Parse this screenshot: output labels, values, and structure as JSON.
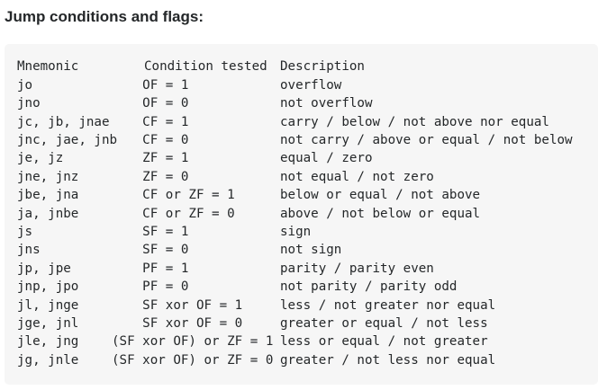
{
  "heading": "Jump conditions and flags:",
  "table": {
    "header": {
      "mnemonic": "Mnemonic",
      "condition": "Condition tested",
      "description": "Description"
    },
    "rows": [
      {
        "mnemonic": "jo",
        "condition": "    OF = 1",
        "description": "overflow"
      },
      {
        "mnemonic": "jno",
        "condition": "    OF = 0",
        "description": "not overflow"
      },
      {
        "mnemonic": "jc, jb, jnae",
        "condition": "    CF = 1",
        "description": "carry / below / not above nor equal"
      },
      {
        "mnemonic": "jnc, jae, jnb",
        "condition": "    CF = 0",
        "description": "not carry / above or equal / not below"
      },
      {
        "mnemonic": "je, jz",
        "condition": "    ZF = 1",
        "description": "equal / zero"
      },
      {
        "mnemonic": "jne, jnz",
        "condition": "    ZF = 0",
        "description": "not equal / not zero"
      },
      {
        "mnemonic": "jbe, jna",
        "condition": "    CF or ZF = 1",
        "description": "below or equal / not above"
      },
      {
        "mnemonic": "ja, jnbe",
        "condition": "    CF or ZF = 0",
        "description": "above / not below or equal"
      },
      {
        "mnemonic": "js",
        "condition": "    SF = 1",
        "description": "sign"
      },
      {
        "mnemonic": "jns",
        "condition": "    SF = 0",
        "description": "not sign"
      },
      {
        "mnemonic": "jp, jpe",
        "condition": "    PF = 1",
        "description": "parity / parity even"
      },
      {
        "mnemonic": "jnp, jpo",
        "condition": "    PF = 0",
        "description": "not parity / parity odd"
      },
      {
        "mnemonic": "jl, jnge",
        "condition": "    SF xor OF = 1",
        "description": "less / not greater nor equal"
      },
      {
        "mnemonic": "jge, jnl",
        "condition": "    SF xor OF = 0",
        "description": "greater or equal / not less"
      },
      {
        "mnemonic": "jle, jng",
        "condition": "(SF xor OF) or ZF = 1",
        "description": "less or equal / not greater"
      },
      {
        "mnemonic": "jg, jnle",
        "condition": "(SF xor OF) or ZF = 0",
        "description": "greater / not less nor equal"
      }
    ]
  }
}
